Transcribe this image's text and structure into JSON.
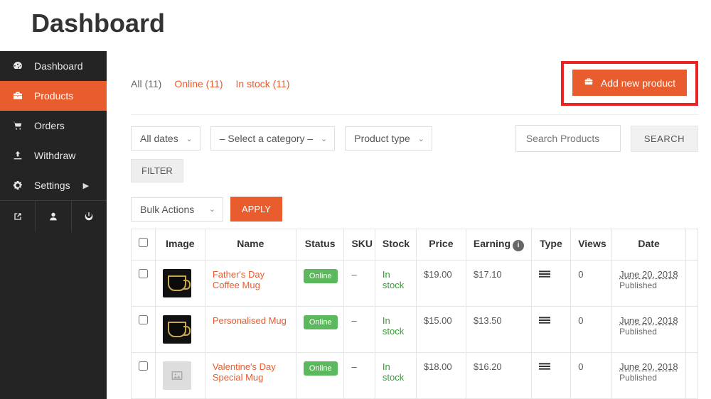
{
  "page_title": "Dashboard",
  "sidebar": {
    "items": [
      {
        "label": "Dashboard",
        "icon": "gauge"
      },
      {
        "label": "Products",
        "icon": "briefcase",
        "active": true
      },
      {
        "label": "Orders",
        "icon": "cart"
      },
      {
        "label": "Withdraw",
        "icon": "upload"
      },
      {
        "label": "Settings",
        "icon": "gear",
        "chevron": true
      }
    ]
  },
  "status_links": {
    "all": "All (11)",
    "online": "Online (11)",
    "instock": "In stock (11)"
  },
  "add_button": "Add new product",
  "filters": {
    "dates": "All dates",
    "category": "– Select a category –",
    "ptype": "Product type",
    "search_placeholder": "Search Products",
    "search_btn": "SEARCH",
    "filter_btn": "FILTER",
    "bulk": "Bulk Actions",
    "apply": "APPLY"
  },
  "table": {
    "headers": {
      "image": "Image",
      "name": "Name",
      "status": "Status",
      "sku": "SKU",
      "stock": "Stock",
      "price": "Price",
      "earning": "Earning",
      "type": "Type",
      "views": "Views",
      "date": "Date"
    },
    "rows": [
      {
        "name": "Father's Day Coffee Mug",
        "status": "Online",
        "sku": "–",
        "stock": "In stock",
        "price": "$19.00",
        "earning": "$17.10",
        "views": "0",
        "date": "June 20, 2018",
        "pub": "Published",
        "thumb": "mug"
      },
      {
        "name": "Personalised Mug",
        "status": "Online",
        "sku": "–",
        "stock": "In stock",
        "price": "$15.00",
        "earning": "$13.50",
        "views": "0",
        "date": "June 20, 2018",
        "pub": "Published",
        "thumb": "mug"
      },
      {
        "name": "Valentine's Day Special Mug",
        "status": "Online",
        "sku": "–",
        "stock": "In stock",
        "price": "$18.00",
        "earning": "$16.20",
        "views": "0",
        "date": "June 20, 2018",
        "pub": "Published",
        "thumb": "blank"
      }
    ]
  }
}
